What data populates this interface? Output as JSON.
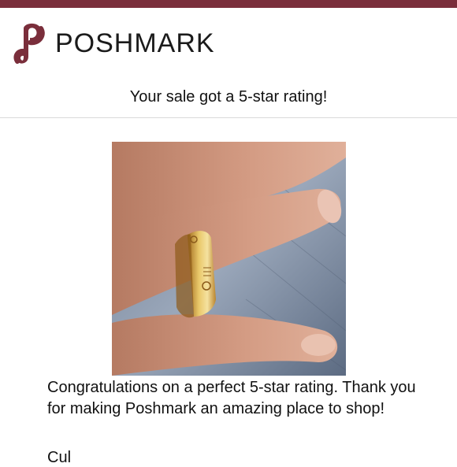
{
  "header": {
    "brand_name": "POSHMARK",
    "logo_icon": "poshmark-p-logo-icon",
    "brand_color": "#7a2e3b"
  },
  "email": {
    "headline": "Your sale got a 5-star rating!",
    "message": "Congratulations on a perfect 5-star rating. Thank you for making Poshmark an amazing place to shop!",
    "signoff_partial": "Cul"
  },
  "image": {
    "subject": "gold-ring-on-finger-photo"
  }
}
